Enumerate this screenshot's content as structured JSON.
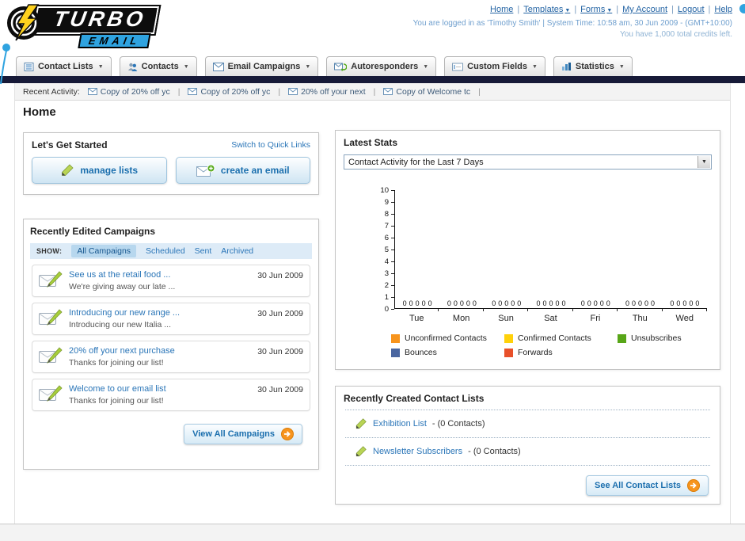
{
  "colors": {
    "link_blue": "#2b76b8",
    "accent_orange": "#f7941d",
    "dark_bar": "#171a38",
    "logo_blue": "#2fa3e0"
  },
  "header": {
    "logo": {
      "line1": "TURBO",
      "line2": "EMAIL"
    },
    "top_links": [
      {
        "label": "Home",
        "dropdown": false
      },
      {
        "label": "Templates",
        "dropdown": true
      },
      {
        "label": "Forms",
        "dropdown": true
      },
      {
        "label": "My Account",
        "dropdown": false
      },
      {
        "label": "Logout",
        "dropdown": false
      },
      {
        "label": "Help",
        "dropdown": false
      }
    ],
    "login_info": "You are logged in as 'Timothy Smith' | System Time: 10:58 am, 30 Jun 2009 - (GMT+10:00)",
    "credits_info": "You have 1,000 total credits left."
  },
  "nav": {
    "tabs": [
      {
        "label": "Contact Lists"
      },
      {
        "label": "Contacts"
      },
      {
        "label": "Email Campaigns"
      },
      {
        "label": "Autoresponders"
      },
      {
        "label": "Custom Fields"
      },
      {
        "label": "Statistics"
      }
    ]
  },
  "activity": {
    "label": "Recent Activity:",
    "items": [
      "Copy of 20% off yc",
      "Copy of 20% off yc",
      "20% off your next",
      "Copy of Welcome tc"
    ]
  },
  "page": {
    "title": "Home",
    "get_started": {
      "title": "Let's Get Started",
      "switch_link": "Switch to Quick Links",
      "manage_lists": "manage lists",
      "create_email": "create an email"
    },
    "campaigns": {
      "title": "Recently Edited Campaigns",
      "show_label": "SHOW:",
      "filters": [
        "All Campaigns",
        "Scheduled",
        "Sent",
        "Archived"
      ],
      "active_filter": "All Campaigns",
      "rows": [
        {
          "title": "See us at the retail food ...",
          "subtitle": "We're giving away our late ...",
          "date": "30 Jun 2009"
        },
        {
          "title": "Introducing our new range ...",
          "subtitle": "Introducing our new Italia ...",
          "date": "30 Jun 2009"
        },
        {
          "title": "20% off your next purchase",
          "subtitle": "Thanks for joining our list!",
          "date": "30 Jun 2009"
        },
        {
          "title": "Welcome to our email list",
          "subtitle": "Thanks for joining our list!",
          "date": "30 Jun 2009"
        }
      ],
      "view_all": "View All Campaigns"
    },
    "stats": {
      "title": "Latest Stats",
      "period": "Contact Activity for the Last 7 Days"
    },
    "contact_lists": {
      "title": "Recently Created Contact Lists",
      "items": [
        {
          "name": "Exhibition List",
          "detail": "- (0 Contacts)"
        },
        {
          "name": "Newsletter Subscribers",
          "detail": "- (0 Contacts)"
        }
      ],
      "see_all": "See All Contact Lists"
    }
  },
  "chart_data": {
    "type": "bar",
    "title": "Contact Activity for the Last 7 Days",
    "categories": [
      "Tue",
      "Mon",
      "Sun",
      "Sat",
      "Fri",
      "Thu",
      "Wed"
    ],
    "series": [
      {
        "name": "Unconfirmed Contacts",
        "color": "#f7941d",
        "values": [
          0,
          0,
          0,
          0,
          0,
          0,
          0
        ]
      },
      {
        "name": "Confirmed Contacts",
        "color": "#ffd10a",
        "values": [
          0,
          0,
          0,
          0,
          0,
          0,
          0
        ]
      },
      {
        "name": "Unsubscribes",
        "color": "#58a618",
        "values": [
          0,
          0,
          0,
          0,
          0,
          0,
          0
        ]
      },
      {
        "name": "Bounces",
        "color": "#4a66a0",
        "values": [
          0,
          0,
          0,
          0,
          0,
          0,
          0
        ]
      },
      {
        "name": "Forwards",
        "color": "#e8502a",
        "values": [
          0,
          0,
          0,
          0,
          0,
          0,
          0
        ]
      }
    ],
    "xlabel": "",
    "ylabel": "",
    "ylim": [
      0,
      10
    ],
    "ytick_step": 1,
    "grid": false,
    "legend_position": "bottom",
    "data_labels_shown": true
  }
}
